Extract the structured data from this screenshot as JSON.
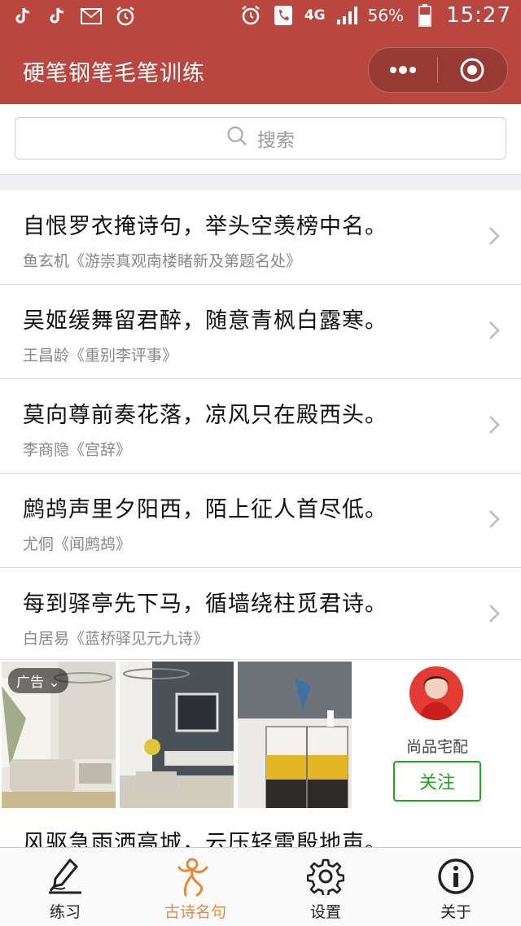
{
  "status_bar": {
    "battery": "56%",
    "network": "4G",
    "time": "15:27"
  },
  "nav": {
    "title": "硬笔钢笔毛笔训练"
  },
  "search": {
    "placeholder": "搜索"
  },
  "poems": [
    {
      "line": "自恨罗衣掩诗句，举头空羡榜中名。",
      "source": "鱼玄机《游崇真观南楼睹新及第题名处》"
    },
    {
      "line": "吴姬缓舞留君醉，随意青枫白露寒。",
      "source": "王昌龄《重别李评事》"
    },
    {
      "line": "莫向尊前奏花落，凉风只在殿西头。",
      "source": "李商隐《宫辞》"
    },
    {
      "line": "鹧鸪声里夕阳西，陌上征人首尽低。",
      "source": "尤侗《闻鹧鸪》"
    },
    {
      "line": "每到驿亭先下马，循墙绕柱觅君诗。",
      "source": "白居易《蓝桥驿见元九诗》"
    }
  ],
  "partial_poem": {
    "line": "风驱急雨洒高城，云压轻雷殷地声。"
  },
  "ad": {
    "tag": "广告",
    "advertiser": "尚品宅配",
    "follow_label": "关注"
  },
  "tabs": [
    {
      "label": "练习",
      "icon": "pen-icon"
    },
    {
      "label": "古诗名句",
      "icon": "dancer-icon",
      "active": true
    },
    {
      "label": "设置",
      "icon": "gear-icon"
    },
    {
      "label": "关于",
      "icon": "info-icon"
    }
  ],
  "colors": {
    "brand": "#b9473f",
    "active_tab": "#e8893a",
    "follow": "#1aad19"
  }
}
